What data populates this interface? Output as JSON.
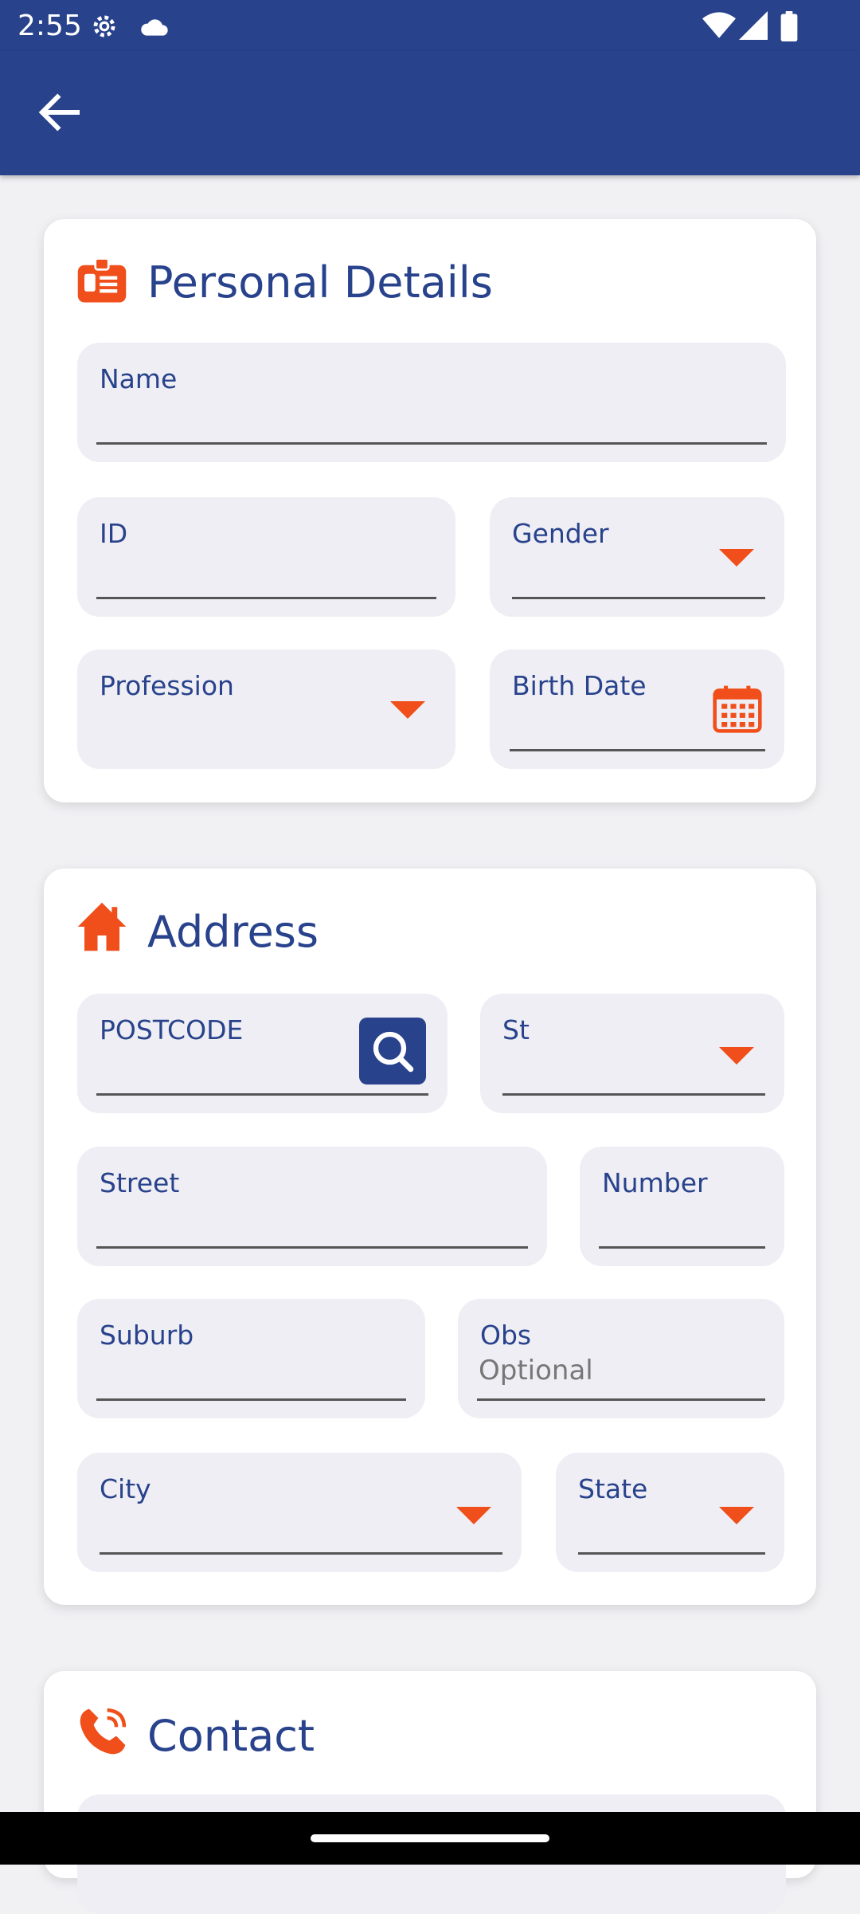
{
  "status_bar": {
    "time": "2:55",
    "icons": [
      "settings-icon",
      "cloud-icon",
      "wifi-icon",
      "signal-icon",
      "battery-icon"
    ]
  },
  "app_bar": {
    "back_icon": "arrow-left-icon"
  },
  "colors": {
    "primary": "#28428c",
    "accent": "#f04e1a",
    "field_bg": "#efeef4"
  },
  "personal": {
    "title": "Personal Details",
    "icon": "id-badge-icon",
    "name_label": "Name",
    "id_label": "ID",
    "gender_label": "Gender",
    "profession_label": "Profession",
    "birth_label": "Birth Date"
  },
  "address": {
    "title": "Address",
    "icon": "home-icon",
    "postcode_label": "POSTCODE",
    "st_label": "St",
    "street_label": "Street",
    "number_label": "Number",
    "suburb_label": "Suburb",
    "obs_label": "Obs",
    "obs_placeholder": "Optional",
    "city_label": "City",
    "state_label": "State"
  },
  "contact": {
    "title": "Contact",
    "icon": "phone-icon"
  }
}
